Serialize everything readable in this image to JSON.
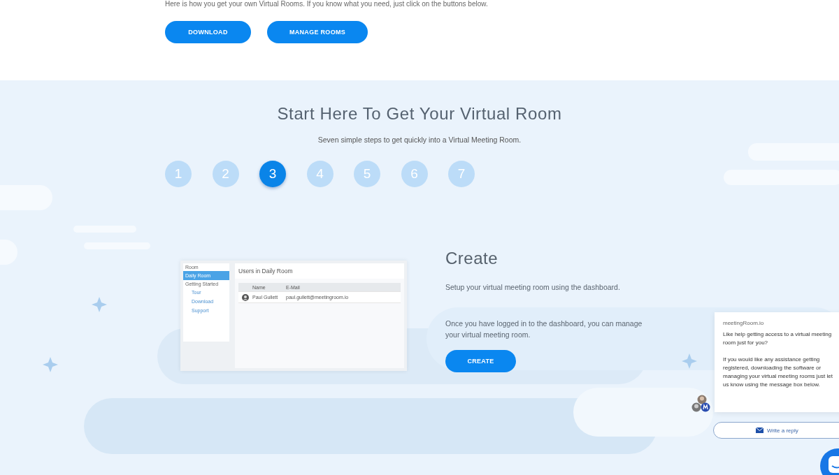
{
  "intro": {
    "text": "Here is how you get your own Virtual Rooms. If you know what you need, just click on the buttons below.",
    "buttons": [
      "DOWNLOAD",
      "MANAGE ROOMS"
    ]
  },
  "steps_section": {
    "title": "Start Here To Get Your Virtual Room",
    "subtitle": "Seven simple steps to get quickly into a Virtual Meeting Room.",
    "steps": [
      {
        "label": "1",
        "selected": false
      },
      {
        "label": "2",
        "selected": false
      },
      {
        "label": "3",
        "selected": true
      },
      {
        "label": "4",
        "selected": false
      },
      {
        "label": "5",
        "selected": false
      },
      {
        "label": "6",
        "selected": false
      },
      {
        "label": "7",
        "selected": false
      }
    ]
  },
  "dashboard": {
    "sidebar": [
      {
        "label": "Room",
        "kind": "heading",
        "selected": false
      },
      {
        "label": "Daily Room",
        "kind": "item",
        "selected": true
      },
      {
        "label": "Getting Started",
        "kind": "heading",
        "selected": false
      },
      {
        "label": "Tour",
        "kind": "link",
        "selected": false
      },
      {
        "label": "Download",
        "kind": "link",
        "selected": false
      },
      {
        "label": "Support",
        "kind": "link",
        "selected": false
      }
    ],
    "title": "Users in Daily Room",
    "columns": [
      "Name",
      "E-Mail"
    ],
    "rows": [
      {
        "name": "Paul Gullett",
        "email": "paul.gullett@meetingroom.io"
      }
    ]
  },
  "step_detail": {
    "heading": "Create",
    "paragraphs": [
      "Setup your virtual meeting room using the dashboard.",
      "Once you have logged in to the dashboard, you can manage your virtual meeting room."
    ],
    "button": "CREATE"
  },
  "chat": {
    "sender": "meetingRoom.io",
    "messages": [
      "Like help getting access to a virtual meeting room just for you?",
      "If you would like any assistance getting registered, downloading the software or managing your virtual meeting rooms just let us know using the message box below."
    ],
    "reply_button": "Write a reply"
  }
}
